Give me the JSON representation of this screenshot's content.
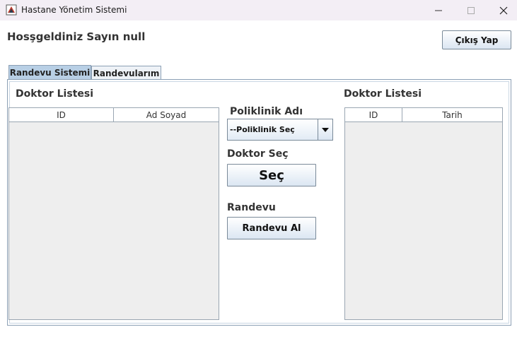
{
  "window": {
    "title": "Hastane Yönetim Sistemi"
  },
  "header": {
    "welcome": "Hosşgeldiniz Sayın null",
    "logout_label": "Çıkış Yap"
  },
  "tabs": [
    {
      "label": "Randevu Sistemi",
      "active": true
    },
    {
      "label": "Randevularım",
      "active": false
    }
  ],
  "left_panel": {
    "title": "Doktor Listesi",
    "columns": [
      "ID",
      "Ad Soyad"
    ],
    "rows": []
  },
  "middle": {
    "poliklinik_label": "Poliklinik Adı",
    "poliklinik_selected": "--Poliklinik Seç",
    "doktor_label": "Doktor Seç",
    "sec_button": "Seç",
    "randevu_label": "Randevu",
    "randevu_button": "Randevu Al"
  },
  "right_panel": {
    "title": "Doktor Listesi",
    "columns": [
      "ID",
      "Tarih"
    ],
    "rows": []
  },
  "colors": {
    "active_tab": "#b8cfe5",
    "panel_border": "#8ca0b5",
    "table_body": "#eeeeee"
  }
}
